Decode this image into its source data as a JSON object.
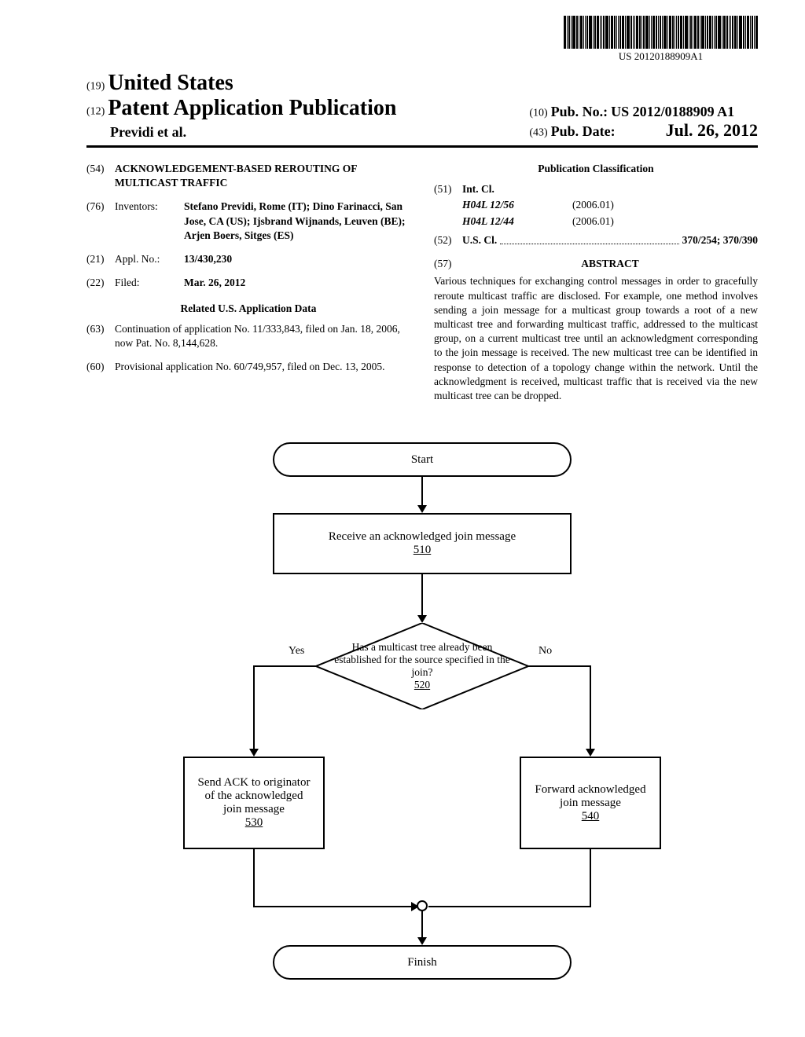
{
  "barcode_text": "US 20120188909A1",
  "header": {
    "country_prefix": "(19)",
    "country": "United States",
    "pub_prefix": "(12)",
    "pub_type": "Patent Application Publication",
    "inventors_hdr": "Previdi et al.",
    "pub_no_prefix": "(10)",
    "pub_no_label": "Pub. No.:",
    "pub_no": "US 2012/0188909 A1",
    "pub_date_prefix": "(43)",
    "pub_date_label": "Pub. Date:",
    "pub_date": "Jul. 26, 2012"
  },
  "left": {
    "title_num": "(54)",
    "title": "ACKNOWLEDGEMENT-BASED REROUTING OF MULTICAST TRAFFIC",
    "inventors_num": "(76)",
    "inventors_label": "Inventors:",
    "inventors": "Stefano Previdi, Rome (IT); Dino Farinacci, San Jose, CA (US); Ijsbrand Wijnands, Leuven (BE); Arjen Boers, Sitges (ES)",
    "appl_num_num": "(21)",
    "appl_num_label": "Appl. No.:",
    "appl_num": "13/430,230",
    "filed_num": "(22)",
    "filed_label": "Filed:",
    "filed": "Mar. 26, 2012",
    "related_hdr": "Related U.S. Application Data",
    "cont_num": "(63)",
    "cont": "Continuation of application No. 11/333,843, filed on Jan. 18, 2006, now Pat. No. 8,144,628.",
    "prov_num": "(60)",
    "prov": "Provisional application No. 60/749,957, filed on Dec. 13, 2005."
  },
  "right": {
    "class_hdr": "Publication Classification",
    "intcl_num": "(51)",
    "intcl_label": "Int. Cl.",
    "ipc1_code": "H04L 12/56",
    "ipc1_ver": "(2006.01)",
    "ipc2_code": "H04L 12/44",
    "ipc2_ver": "(2006.01)",
    "uscl_num": "(52)",
    "uscl_label": "U.S. Cl.",
    "uscl_vals": "370/254; 370/390",
    "abstract_num": "(57)",
    "abstract_label": "ABSTRACT",
    "abstract": "Various techniques for exchanging control messages in order to gracefully reroute multicast traffic are disclosed. For example, one method involves sending a join message for a multicast group towards a root of a new multicast tree and forwarding multicast traffic, addressed to the multicast group, on a current multicast tree until an acknowledgment corresponding to the join message is received. The new multicast tree can be identified in response to detection of a topology change within the network. Until the acknowledgment is received, multicast traffic that is received via the new multicast tree can be dropped."
  },
  "chart_data": {
    "type": "flowchart",
    "nodes": {
      "start": "Start",
      "step510_text": "Receive an acknowledged join message",
      "step510_ref": "510",
      "dec520_text": "Has a multicast tree already been established for the source specified in the join?",
      "dec520_ref": "520",
      "dec_yes": "Yes",
      "dec_no": "No",
      "step530_text": "Send ACK to originator of the acknowledged join message",
      "step530_ref": "530",
      "step540_text": "Forward acknowledged join message",
      "step540_ref": "540",
      "finish": "Finish"
    }
  }
}
